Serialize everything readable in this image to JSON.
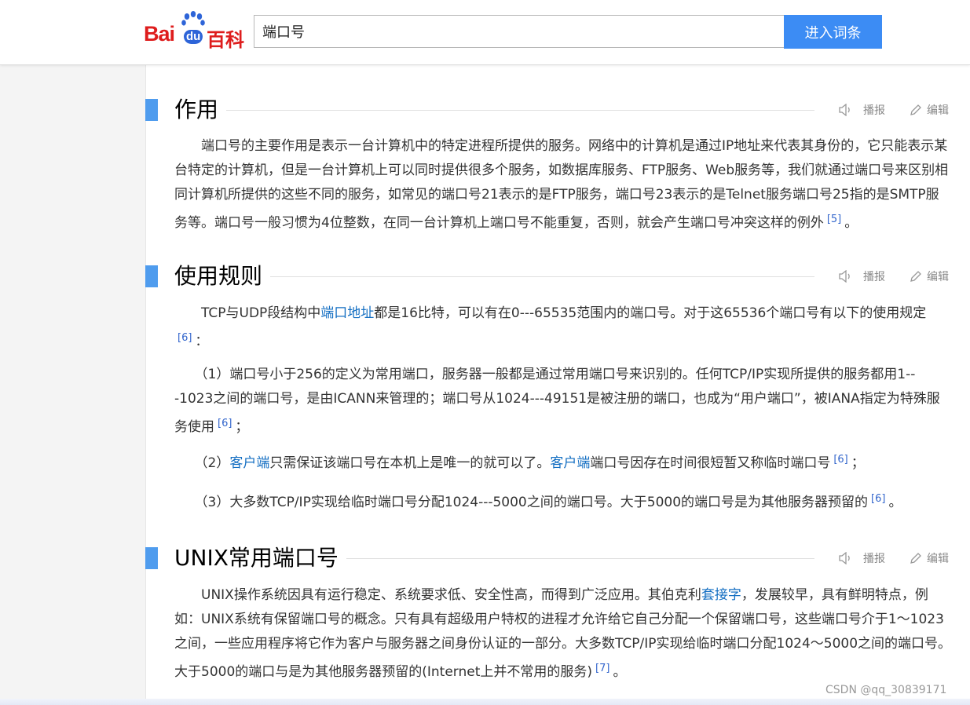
{
  "header": {
    "logo_text": "Bai",
    "logo_du": "du",
    "logo_baike": "百科",
    "search_value": "端口号",
    "search_button": "进入词条"
  },
  "actions": {
    "play": "播报",
    "edit": "编辑"
  },
  "sections": [
    {
      "title": "作用",
      "paragraphs": [
        {
          "text_a": "　　端口号的主要作用是表示一台计算机中的特定进程所提供的服务。网络中的计算机是通过IP地址来代表其身份的，它只能表示某台特定的计算机，但是一台计算机上可以同时提供很多个服务，如数据库服务、FTP服务、Web服务等，我们就通过端口号来区别相同计算机所提供的这些不同的服务，如常见的端口号21表示的是FTP服务，端口号23表示的是Telnet服务端口号25指的是SMTP服务等。端口号一般习惯为4位整数，在同一台计算机上端口号不能重复，否则，就会产生端口号冲突这样的例外",
          "ref": "[5]",
          "text_b": "。"
        }
      ]
    },
    {
      "title": "使用规则",
      "paragraphs": [
        {
          "pre": "　　TCP与UDP段结构中",
          "link": "端口地址",
          "post": "都是16比特，可以有在0---65535范围内的端口号。对于这65536个端口号有以下的使用规定",
          "ref": "[6]",
          "end": "："
        },
        {
          "pre": "　　（1）端口号小于256的定义为常用端口，服务器一般都是通过常用端口号来识别的。任何TCP/IP实现所提供的服务都用1---1023之间的端口号，是由ICANN来管理的；端口号从1024---49151是被注册的端口，也成为“用户端口”，被IANA指定为特殊服务使用",
          "ref": "[6]",
          "end": "；"
        },
        {
          "pre": "　　（2）",
          "link": "客户端",
          "mid": "只需保证该端口号在本机上是唯一的就可以了。",
          "link2": "客户端",
          "post": "端口号因存在时间很短暂又称临时端口号",
          "ref": "[6]",
          "end": "；"
        },
        {
          "pre": "　　（3）大多数TCP/IP实现给临时端口号分配1024---5000之间的端口号。大于5000的端口号是为其他服务器预留的",
          "ref": "[6]",
          "end": "。"
        }
      ]
    },
    {
      "title": "UNIX常用端口号",
      "paragraphs": [
        {
          "pre": "　　UNIX操作系统因具有运行稳定、系统要求低、安全性高，而得到广泛应用。其伯克利",
          "link": "套接字",
          "post": "，发展较早，具有鲜明特点，例如：UNIX系统有保留端口号的概念。只有具有超级用户特权的进程才允许给它自己分配一个保留端口号，这些端口号介于1～1023之间，一些应用程序将它作为客户与服务器之间身份认证的一部分。大多数TCP/IP实现给临时端口分配1024～5000之间的端口号。大于5000的端口与是为其他服务器预留的(Internet上并不常用的服务)",
          "ref": "[7]",
          "end": "。"
        }
      ]
    }
  ],
  "watermark": "CSDN @qq_30839171",
  "colors": {
    "accent": "#4f9cee",
    "button": "#3c8cf4",
    "brand_red": "#de1d1d",
    "link": "#136ec2"
  }
}
